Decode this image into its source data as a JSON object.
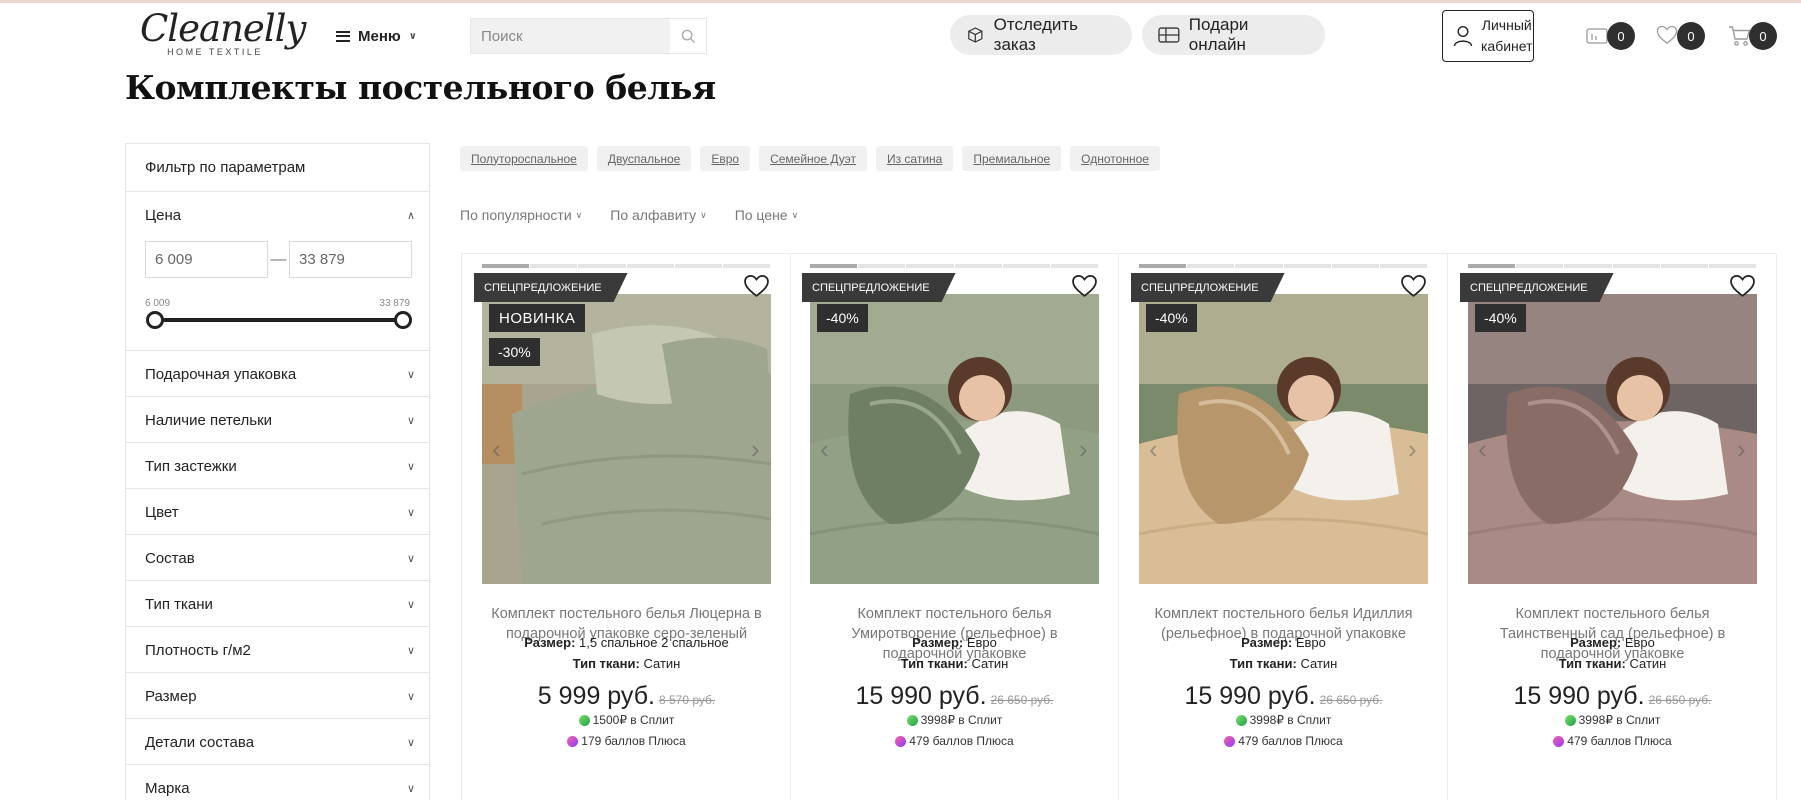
{
  "header": {
    "logo_main": "Cleanelly",
    "logo_sub": "HOME TEXTILE",
    "menu_label": "Меню",
    "search_placeholder": "Поиск",
    "track_order_label": "Отследить заказ",
    "gift_online_label": "Подари онлайн",
    "account_line1": "Личный",
    "account_line2": "кабинет",
    "compare_count": "0",
    "favorites_count": "0",
    "cart_count": "0"
  },
  "page": {
    "title": "Комплекты постельного белья"
  },
  "sidebar": {
    "title": "Фильтр по параметрам",
    "price": {
      "label": "Цена",
      "min_value": "6 009",
      "max_value": "33 879",
      "range_min_label": "6 009",
      "range_max_label": "33 879"
    },
    "filters": [
      "Подарочная упаковка",
      "Наличие петельки",
      "Тип застежки",
      "Цвет",
      "Состав",
      "Тип ткани",
      "Плотность г/м2",
      "Размер",
      "Детали состава",
      "Марка"
    ]
  },
  "tags": [
    "Полутороспальное",
    "Двуспальное",
    "Евро",
    "Семейное Дуэт",
    "Из сатина",
    "Премиальное",
    "Однотонное"
  ],
  "sort": [
    "По популярности",
    "По алфавиту",
    "По цене"
  ],
  "products": [
    {
      "special": "СПЕЦПРЕДЛОЖЕНИЕ",
      "is_new": true,
      "new_label": "НОВИНКА",
      "discount": "-30%",
      "name": "Комплект постельного белья Люцерна в подарочной упаковке серо-зеленый",
      "size_label": "Размер:",
      "size_value": "1,5 спальное 2 спальное",
      "fabric_label": "Тип ткани:",
      "fabric_value": "Сатин",
      "price": "5 999 руб.",
      "old_price": "8 570 руб.",
      "split": "1500₽ в Сплит",
      "plus": "179 баллов Плюса",
      "palette": {
        "bg": "#a8a48f",
        "main": "#9fa690",
        "dark": "#7f876f",
        "light": "#c4c7b2",
        "accent": "#b88a55"
      }
    },
    {
      "special": "СПЕЦПРЕДЛОЖЕНИЕ",
      "is_new": false,
      "new_label": "",
      "discount": "-40%",
      "name": "Комплект постельного белья Умиротворение (рельефное) в подарочной упаковке",
      "size_label": "Размер:",
      "size_value": "Евро",
      "fabric_label": "Тип ткани:",
      "fabric_value": "Сатин",
      "price": "15 990 руб.",
      "old_price": "26 650 руб.",
      "split": "3998₽ в Сплит",
      "plus": "479 баллов Плюса",
      "palette": {
        "bg": "#8e9a80",
        "main": "#92a186",
        "dark": "#6f7f64",
        "light": "#b6c2a8",
        "accent": "#d9c1a6"
      }
    },
    {
      "special": "СПЕЦПРЕДЛОЖЕНИЕ",
      "is_new": false,
      "new_label": "",
      "discount": "-40%",
      "name": "Комплект постельного белья Идиллия (рельефное) в подарочной упаковке",
      "size_label": "Размер:",
      "size_value": "Евро",
      "fabric_label": "Тип ткани:",
      "fabric_value": "Сатин",
      "price": "15 990 руб.",
      "old_price": "26 650 руб.",
      "split": "3998₽ в Сплит",
      "plus": "479 баллов Плюса",
      "palette": {
        "bg": "#7c8a6c",
        "main": "#d9bd97",
        "dark": "#b7966c",
        "light": "#ead7bc",
        "accent": "#d9c1a6"
      }
    },
    {
      "special": "СПЕЦПРЕДЛОЖЕНИЕ",
      "is_new": false,
      "new_label": "",
      "discount": "-40%",
      "name": "Комплект постельного белья Таинственный сад (рельефное) в подарочной упаковке",
      "size_label": "Размер:",
      "size_value": "Евро",
      "fabric_label": "Тип ткани:",
      "fabric_value": "Сатин",
      "price": "15 990 руб.",
      "old_price": "26 650 руб.",
      "split": "3998₽ в Сплит",
      "plus": "479 баллов Плюса",
      "palette": {
        "bg": "#6d6463",
        "main": "#a98a85",
        "dark": "#8a6c67",
        "light": "#c6aaa4",
        "accent": "#d9c1a6"
      }
    }
  ]
}
